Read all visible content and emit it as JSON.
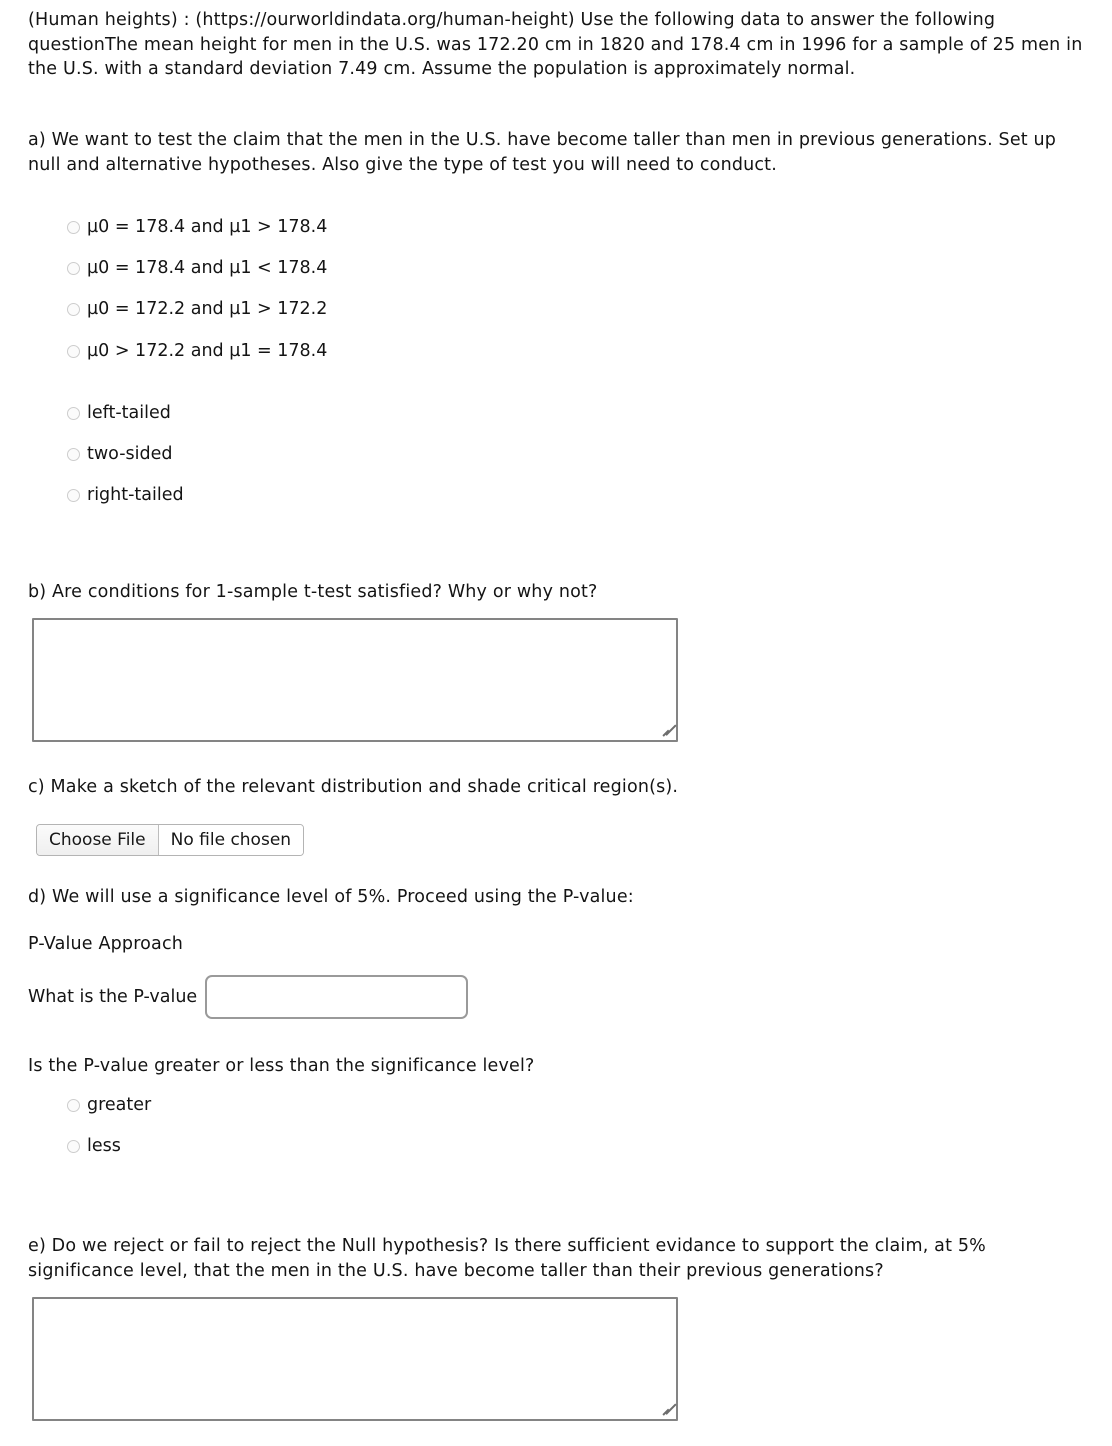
{
  "document": {
    "intro": "(Human heights) : (https://ourworldindata.org/human-height) Use the following data to answer the following questionThe mean height for men in the U.S. was 172.20 cm in 1820 and 178.4 cm in 1996 for a sample of 25 men in the U.S. with a standard deviation 7.49 cm. Assume the population is approximately normal.",
    "question_a": "a) We want to test the claim that the men in the U.S. have become taller than men in previous generations. Set up null and alternative hypotheses. Also give the type of test you will need to conduct.",
    "question_b": "b) Are conditions for 1-sample t-test satisfied? Why or why not?",
    "question_c": "c) Make a sketch of the relevant distribution and shade critical region(s).",
    "question_d": "d) We will use a significance level of 5%. Proceed using the P-value:",
    "pvalue_approach_heading": "P-Value Approach",
    "pvalue_question": "What is the P-value",
    "pvalue_compare_question": "Is the P-value greater or less than the significance level?",
    "question_e": "e) Do we reject or fail to reject the Null hypothesis? Is there sufficient evidance to support the claim, at 5% significance level, that the men in the U.S. have become taller than their previous generations?"
  },
  "hypothesis_options": [
    {
      "id": "h1",
      "label": "µ0 = 178.4 and µ1 > 178.4",
      "selected": false
    },
    {
      "id": "h2",
      "label": "µ0 = 178.4 and µ1 < 178.4",
      "selected": false
    },
    {
      "id": "h3",
      "label": "µ0 = 172.2 and µ1 > 172.2",
      "selected": false
    },
    {
      "id": "h4",
      "label": "µ0 > 172.2 and µ1 = 178.4",
      "selected": false
    }
  ],
  "tail_options": [
    {
      "id": "t1",
      "label": "left-tailed",
      "selected": false
    },
    {
      "id": "t2",
      "label": "two-sided",
      "selected": false
    },
    {
      "id": "t3",
      "label": "right-tailed",
      "selected": false
    }
  ],
  "pvalue_compare_options": [
    {
      "id": "p1",
      "label": "greater",
      "selected": false
    },
    {
      "id": "p2",
      "label": "less",
      "selected": false
    }
  ],
  "file_upload": {
    "button_label": "Choose File",
    "status_text": "No file chosen"
  },
  "answers": {
    "textarea_b_value": "",
    "textarea_e_value": "",
    "pvalue_input_value": ""
  },
  "colors": {
    "text": "#141414",
    "field_border": "#848484",
    "input_border": "#9a9a9a",
    "radio_border": "#cdcdcd",
    "background": "#ffffff"
  }
}
